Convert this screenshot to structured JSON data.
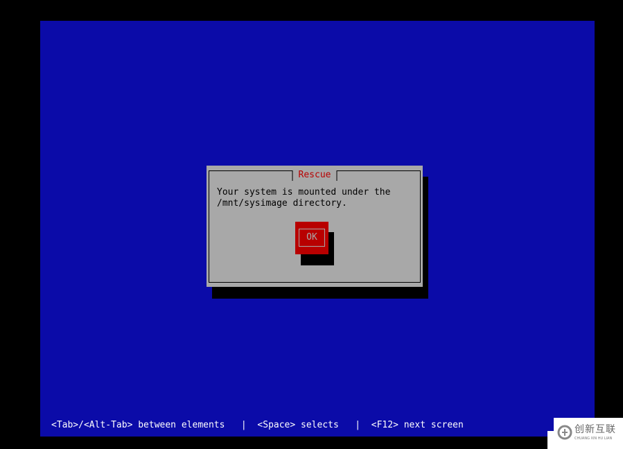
{
  "dialog": {
    "title": "Rescue",
    "message": "Your system is mounted under the\n/mnt/sysimage directory.",
    "ok_label": "OK"
  },
  "status_bar": {
    "text": "<Tab>/<Alt-Tab> between elements   |  <Space> selects   |  <F12> next screen"
  },
  "watermark": {
    "logo_icon": "chuangxin-logo-icon",
    "text": "创新互联",
    "subtext": "CHUANG XIN HU LIAN"
  },
  "colors": {
    "background": "#0b0ba8",
    "dialog": "#a8a8a8",
    "accent_red": "#b80000",
    "shadow": "#000000",
    "status_text": "#ffffff"
  }
}
